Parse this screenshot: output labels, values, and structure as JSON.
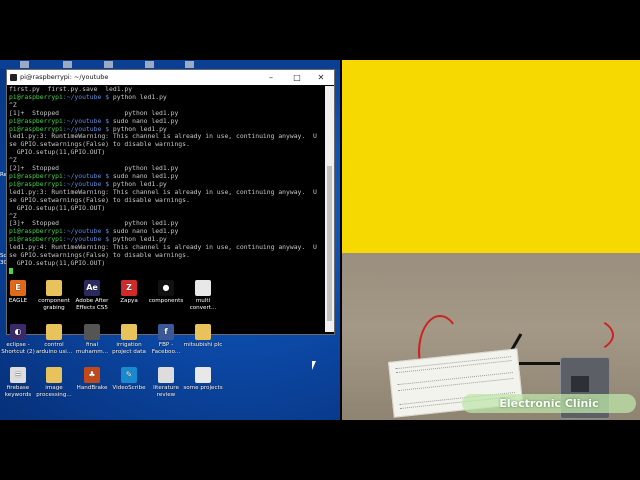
{
  "terminal": {
    "title": "pi@raspberrypi: ~/youtube",
    "lines": [
      [
        {
          "t": "first.py  first.py.save  led1.py",
          "k": ""
        }
      ],
      [
        {
          "t": "pi@raspberrypi",
          "k": "p"
        },
        {
          "t": ":~/youtube $ ",
          "k": "d"
        },
        {
          "t": "python led1.py",
          "k": ""
        }
      ],
      [
        {
          "t": "^Z",
          "k": ""
        }
      ],
      [
        {
          "t": "[1]+  Stopped                 python led1.py",
          "k": ""
        }
      ],
      [
        {
          "t": "pi@raspberrypi",
          "k": "p"
        },
        {
          "t": ":~/youtube $ ",
          "k": "d"
        },
        {
          "t": "sudo nano led1.py",
          "k": ""
        }
      ],
      [
        {
          "t": "pi@raspberrypi",
          "k": "p"
        },
        {
          "t": ":~/youtube $ ",
          "k": "d"
        },
        {
          "t": "python led1.py",
          "k": ""
        }
      ],
      [
        {
          "t": "led1.py:3: RuntimeWarning: This channel is already in use, continuing anyway.  U",
          "k": ""
        }
      ],
      [
        {
          "t": "se GPIO.setwarnings(False) to disable warnings.",
          "k": ""
        }
      ],
      [
        {
          "t": "  GPIO.setup(11,GPIO.OUT)",
          "k": ""
        }
      ],
      [
        {
          "t": "^Z",
          "k": ""
        }
      ],
      [
        {
          "t": "[2]+  Stopped                 python led1.py",
          "k": ""
        }
      ],
      [
        {
          "t": "pi@raspberrypi",
          "k": "p"
        },
        {
          "t": ":~/youtube $ ",
          "k": "d"
        },
        {
          "t": "sudo nano led1.py",
          "k": ""
        }
      ],
      [
        {
          "t": "pi@raspberrypi",
          "k": "p"
        },
        {
          "t": ":~/youtube $ ",
          "k": "d"
        },
        {
          "t": "python led1.py",
          "k": ""
        }
      ],
      [
        {
          "t": "led1.py:3: RuntimeWarning: This channel is already in use, continuing anyway.  U",
          "k": ""
        }
      ],
      [
        {
          "t": "se GPIO.setwarnings(False) to disable warnings.",
          "k": ""
        }
      ],
      [
        {
          "t": "  GPIO.setup(11,GPIO.OUT)",
          "k": ""
        }
      ],
      [
        {
          "t": "^Z",
          "k": ""
        }
      ],
      [
        {
          "t": "[3]+  Stopped                 python led1.py",
          "k": ""
        }
      ],
      [
        {
          "t": "pi@raspberrypi",
          "k": "p"
        },
        {
          "t": ":~/youtube $ ",
          "k": "d"
        },
        {
          "t": "sudo nano led1.py",
          "k": ""
        }
      ],
      [
        {
          "t": "pi@raspberrypi",
          "k": "p"
        },
        {
          "t": ":~/youtube $ ",
          "k": "d"
        },
        {
          "t": "python led1.py",
          "k": ""
        }
      ],
      [
        {
          "t": "led1.py:4: RuntimeWarning: This channel is already in use, continuing anyway.  U",
          "k": ""
        }
      ],
      [
        {
          "t": "se GPIO.setwarnings(False) to disable warnings.",
          "k": ""
        }
      ],
      [
        {
          "t": "  GPIO.setup(11,GPIO.OUT)",
          "k": ""
        }
      ],
      [
        {
          "t": "",
          "k": "cursor"
        }
      ]
    ]
  },
  "edge": {
    "a": "Sc",
    "b": "30",
    "c": "Re"
  },
  "icons": [
    {
      "label": "EAGLE",
      "glyph": "E",
      "color": "#e06a1a"
    },
    {
      "label": "component grabing",
      "glyph": "",
      "color": "#e8c25a"
    },
    {
      "label": "Adobe After Effects CS5",
      "glyph": "Ae",
      "color": "#2a2a5e"
    },
    {
      "label": "Zapya",
      "glyph": "Z",
      "color": "#d02a2a"
    },
    {
      "label": "components",
      "glyph": "●",
      "color": "#111111"
    },
    {
      "label": "multi convert...",
      "glyph": "",
      "color": "#e8e8e8"
    },
    {
      "label": "eclipse - Shortcut (2)",
      "glyph": "◐",
      "color": "#3a2a6a"
    },
    {
      "label": "control arduino usi...",
      "glyph": "",
      "color": "#e8c25a"
    },
    {
      "label": "final muhamm...",
      "glyph": "",
      "color": "#555555"
    },
    {
      "label": "irrigation project data",
      "glyph": "",
      "color": "#e8c25a"
    },
    {
      "label": "FBP - Faceboo...",
      "glyph": "f",
      "color": "#3b5998"
    },
    {
      "label": "mitsubishi plc",
      "glyph": "",
      "color": "#e8c25a"
    },
    {
      "label": "firebase keywords",
      "glyph": "≡",
      "color": "#dddddd"
    },
    {
      "label": "image processing...",
      "glyph": "",
      "color": "#e8c25a"
    },
    {
      "label": "HandBrake",
      "glyph": "♣",
      "color": "#c24a1a"
    },
    {
      "label": "VideoScribe",
      "glyph": "✎",
      "color": "#1a8ad0"
    },
    {
      "label": "literature review",
      "glyph": "",
      "color": "#dddddd"
    },
    {
      "label": "some projects",
      "glyph": "",
      "color": "#e8e8e8"
    }
  ],
  "watermark": "Electronic Clinic"
}
